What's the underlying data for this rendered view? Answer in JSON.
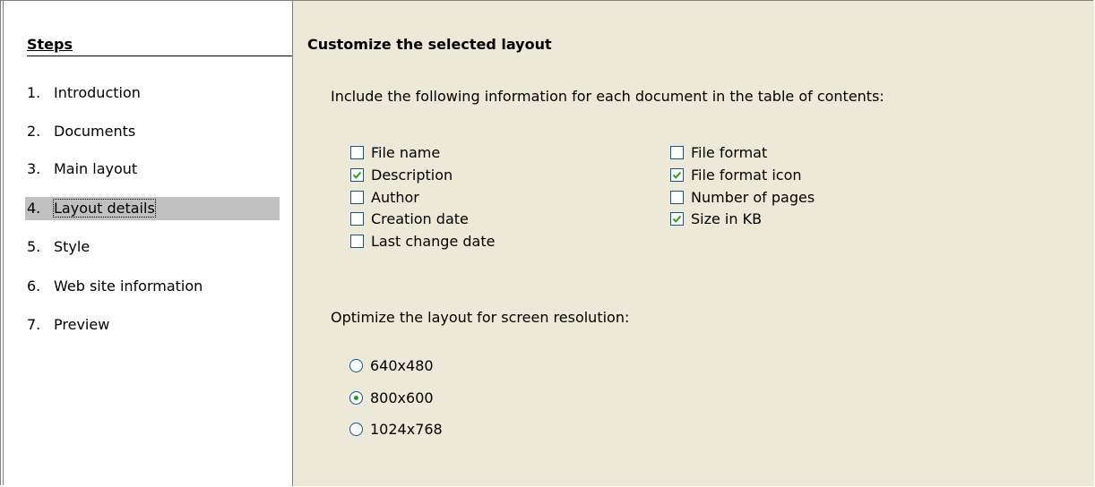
{
  "sidebar": {
    "title": "Steps",
    "items": [
      {
        "num": "1.",
        "label": "Introduction",
        "active": false
      },
      {
        "num": "2.",
        "label": "Documents",
        "active": false
      },
      {
        "num": "3.",
        "label": "Main layout",
        "active": false
      },
      {
        "num": "4.",
        "label": "Layout details",
        "active": true
      },
      {
        "num": "5.",
        "label": "Style",
        "active": false
      },
      {
        "num": "6.",
        "label": "Web site information",
        "active": false
      },
      {
        "num": "7.",
        "label": "Preview",
        "active": false
      }
    ]
  },
  "content": {
    "title": "Customize the selected layout",
    "info_text": "Include the following information for each document in the table of contents:",
    "checkboxes_left": [
      {
        "label": "File name",
        "checked": false
      },
      {
        "label": "Description",
        "checked": true
      },
      {
        "label": "Author",
        "checked": false
      },
      {
        "label": "Creation date",
        "checked": false
      },
      {
        "label": "Last change date",
        "checked": false
      }
    ],
    "checkboxes_right": [
      {
        "label": "File format",
        "checked": false
      },
      {
        "label": "File format icon",
        "checked": true
      },
      {
        "label": "Number of pages",
        "checked": false
      },
      {
        "label": "Size in KB",
        "checked": true
      }
    ],
    "resolution_text": "Optimize the layout for screen resolution:",
    "resolutions": [
      {
        "label": "640x480",
        "selected": false
      },
      {
        "label": "800x600",
        "selected": true
      },
      {
        "label": "1024x768",
        "selected": false
      }
    ]
  },
  "colors": {
    "check": "#21a121",
    "selected_step_bg": "#c0c0c0",
    "panel_bg": "#ece9d8"
  }
}
